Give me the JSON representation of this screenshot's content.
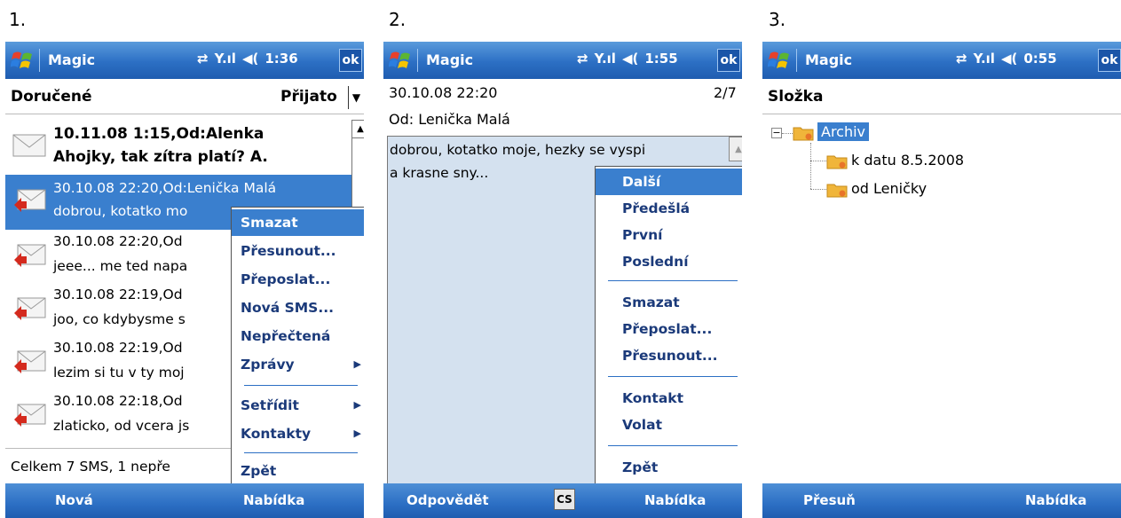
{
  "step_labels": [
    "1.",
    "2.",
    "3."
  ],
  "statusbar": {
    "app_title": "Magic",
    "ok": "ok",
    "screen1_time": "1:36",
    "screen2_time": "1:55",
    "screen3_time": "0:55",
    "sync_icon": "sync-arrows-icon",
    "signal_icon": "signal-icon",
    "volume_icon": "volume-icon"
  },
  "screen1": {
    "folder_title": "Doručené",
    "sort_label": "Přijato",
    "messages": [
      {
        "line1": "10.11.08 1:15,Od:Alenka",
        "line2": "Ahojky, tak zítra platí? A.",
        "unread": true
      },
      {
        "line1": "30.10.08 22:20,Od:Lenička Malá",
        "line2": "dobrou, kotatko mo",
        "selected": true
      },
      {
        "line1": "30.10.08 22:20,Od",
        "line2": "jeee... me ted napa"
      },
      {
        "line1": "30.10.08 22:19,Od",
        "line2": "joo, co kdybysme s"
      },
      {
        "line1": "30.10.08 22:19,Od",
        "line2": "lezim si tu v ty moj"
      },
      {
        "line1": "30.10.08 22:18,Od",
        "line2": "zlaticko, od vcera js"
      }
    ],
    "summary": "Celkem 7 SMS, 1 nepře",
    "menu": [
      "Smazat",
      "Přesunout...",
      "Přeposlat...",
      "Nová SMS...",
      "Nepřečtená",
      "Zprávy",
      "Setřídit",
      "Kontakty",
      "Zpět"
    ],
    "softkey_left": "Nová",
    "softkey_right": "Nabídka"
  },
  "screen2": {
    "datetime": "30.10.08 22:20",
    "position": "2/7",
    "from": "Od: Lenička Malá",
    "body_line1": "dobrou, kotatko moje, hezky se vyspi",
    "body_line2": "a krasne sny...",
    "menu": [
      "Další",
      "Předešlá",
      "První",
      "Poslední",
      "Smazat",
      "Přeposlat...",
      "Přesunout...",
      "Kontakt",
      "Volat",
      "Zpět"
    ],
    "softkey_left": "Odpovědět",
    "input_mode": "CS",
    "softkey_right": "Nabídka"
  },
  "screen3": {
    "title": "Složka",
    "tree_root": "Archiv",
    "tree_children": [
      "k datu 8.5.2008",
      "od Leničky"
    ],
    "softkey_left": "Přesuň",
    "softkey_right": "Nabídka"
  }
}
